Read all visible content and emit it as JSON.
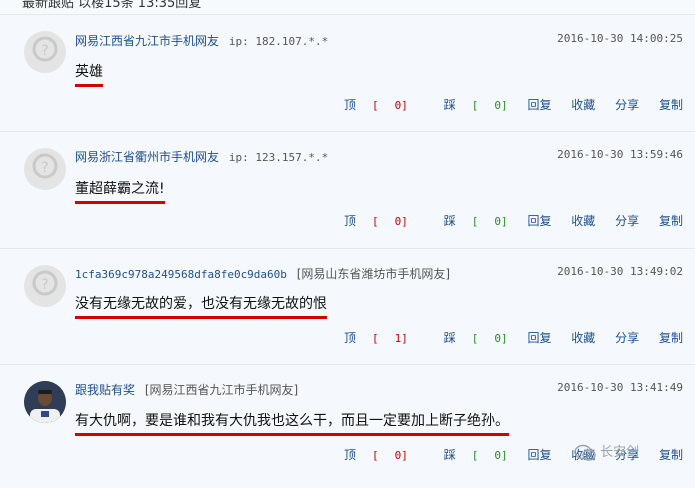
{
  "top_partial": "最新跟贴  以楼15条 13:35回复",
  "comments": [
    {
      "username": "网易江西省九江市手机网友",
      "ip_label": "ip:",
      "ip": "182.107.*.*",
      "time": "2016-10-30 14:00:25",
      "content": "英雄",
      "up": "0",
      "down": "0"
    },
    {
      "username": "网易浙江省衢州市手机网友",
      "ip_label": "ip:",
      "ip": "123.157.*.*",
      "time": "2016-10-30 13:59:46",
      "content": "董超薛霸之流!",
      "up": "0",
      "down": "0"
    },
    {
      "username": "1cfa369c978a249568dfa8fe0c9da60b",
      "location": "[网易山东省潍坊市手机网友]",
      "time": "2016-10-30 13:49:02",
      "content": "没有无缘无故的爱，也没有无缘无故的恨",
      "up": "1",
      "down": "0"
    },
    {
      "username": "跟我贴有奖",
      "location": "[网易江西省九江市手机网友]",
      "time": "2016-10-30 13:41:49",
      "content": "有大仇啊，要是谁和我有大仇我也这么干，而且一定要加上断子绝孙。",
      "up": "0",
      "down": "0"
    }
  ],
  "actions": {
    "up": "顶",
    "down": "踩",
    "reply": "回复",
    "favorite": "收藏",
    "share": "分享",
    "copy": "复制"
  },
  "watermark": "长安剑",
  "colors": {
    "underline": "#d40000",
    "link": "#1f4f8f",
    "up_count": "#cc0000",
    "down_count": "#2a8a2a"
  }
}
